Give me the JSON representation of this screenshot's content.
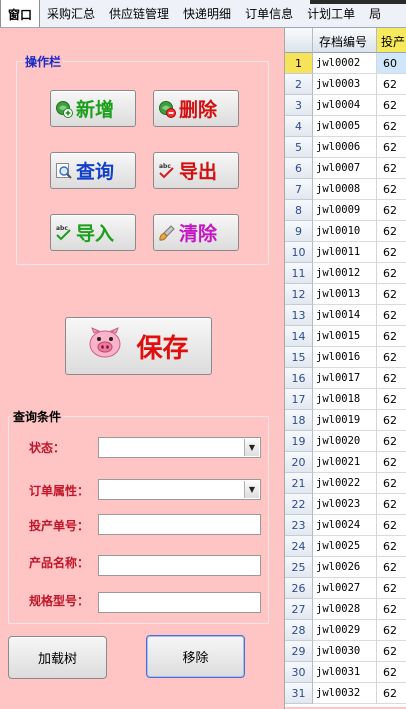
{
  "menu": {
    "items": [
      "窗口",
      "采购汇总",
      "供应链管理",
      "快递明细",
      "订单信息",
      "计划工单",
      "局"
    ]
  },
  "operations": {
    "title": "操作栏",
    "add": "新增",
    "delete": "删除",
    "query": "查询",
    "export": "导出",
    "import": "导入",
    "clear": "清除"
  },
  "save": {
    "label": "保存"
  },
  "query": {
    "title": "查询条件",
    "status_label": "状态：",
    "status_value": "",
    "order_attr_label": "订单属性：",
    "order_attr_value": "",
    "production_no_label": "投产单号：",
    "production_no_value": "",
    "product_name_label": "产品名称：",
    "product_name_value": "",
    "spec_label": "规格型号：",
    "spec_value": ""
  },
  "bottom": {
    "load_tree": "加载树",
    "remove": "移除"
  },
  "grid": {
    "headers": [
      "存档编号",
      "投产"
    ],
    "rows": [
      {
        "n": "1",
        "code": "jwl0002",
        "v": "60"
      },
      {
        "n": "2",
        "code": "jwl0003",
        "v": "62"
      },
      {
        "n": "3",
        "code": "jwl0004",
        "v": "62"
      },
      {
        "n": "4",
        "code": "jwl0005",
        "v": "62"
      },
      {
        "n": "5",
        "code": "jwl0006",
        "v": "62"
      },
      {
        "n": "6",
        "code": "jwl0007",
        "v": "62"
      },
      {
        "n": "7",
        "code": "jwl0008",
        "v": "62"
      },
      {
        "n": "8",
        "code": "jwl0009",
        "v": "62"
      },
      {
        "n": "9",
        "code": "jwl0010",
        "v": "62"
      },
      {
        "n": "10",
        "code": "jwl0011",
        "v": "62"
      },
      {
        "n": "11",
        "code": "jwl0012",
        "v": "62"
      },
      {
        "n": "12",
        "code": "jwl0013",
        "v": "62"
      },
      {
        "n": "13",
        "code": "jwl0014",
        "v": "62"
      },
      {
        "n": "14",
        "code": "jwl0015",
        "v": "62"
      },
      {
        "n": "15",
        "code": "jwl0016",
        "v": "62"
      },
      {
        "n": "16",
        "code": "jwl0017",
        "v": "62"
      },
      {
        "n": "17",
        "code": "jwl0018",
        "v": "62"
      },
      {
        "n": "18",
        "code": "jwl0019",
        "v": "62"
      },
      {
        "n": "19",
        "code": "jwl0020",
        "v": "62"
      },
      {
        "n": "20",
        "code": "jwl0021",
        "v": "62"
      },
      {
        "n": "21",
        "code": "jwl0022",
        "v": "62"
      },
      {
        "n": "22",
        "code": "jwl0023",
        "v": "62"
      },
      {
        "n": "23",
        "code": "jwl0024",
        "v": "62"
      },
      {
        "n": "24",
        "code": "jwl0025",
        "v": "62"
      },
      {
        "n": "25",
        "code": "jwl0026",
        "v": "62"
      },
      {
        "n": "26",
        "code": "jwl0027",
        "v": "62"
      },
      {
        "n": "27",
        "code": "jwl0028",
        "v": "62"
      },
      {
        "n": "28",
        "code": "jwl0029",
        "v": "62"
      },
      {
        "n": "29",
        "code": "jwl0030",
        "v": "62"
      },
      {
        "n": "30",
        "code": "jwl0031",
        "v": "62"
      },
      {
        "n": "31",
        "code": "jwl0032",
        "v": "62"
      }
    ]
  },
  "colors": {
    "panel_bg": "#ffc4c4",
    "label_red": "#c0162a",
    "ops_title_blue": "#1b2bc9",
    "selected_row": "#f7e35a"
  }
}
